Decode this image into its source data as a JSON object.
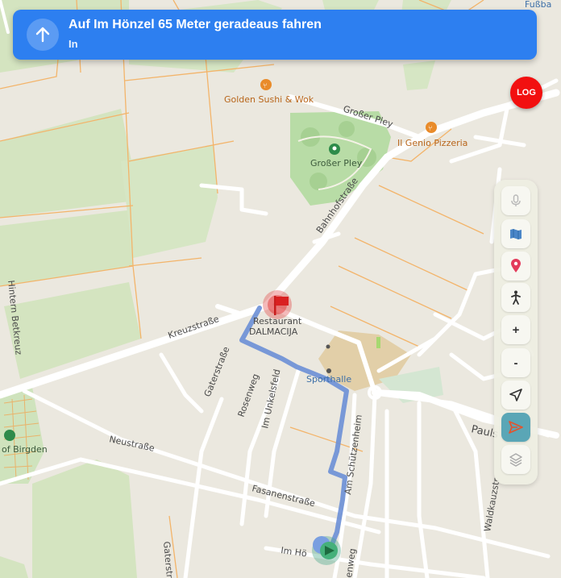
{
  "banner": {
    "instruction": "Auf Im Hönzel 65 Meter geradeaus fahren",
    "subtitle": "In",
    "color": "#2d7ff0"
  },
  "log_button": {
    "label": "LOG",
    "color": "#f21010"
  },
  "toolbar": {
    "items": [
      {
        "icon": "microphone-icon",
        "label": ""
      },
      {
        "icon": "map-book-icon",
        "label": ""
      },
      {
        "icon": "location-pin-icon",
        "label": ""
      },
      {
        "icon": "walking-person-icon",
        "label": ""
      },
      {
        "icon": "zoom-in-icon",
        "label": "+"
      },
      {
        "icon": "zoom-out-icon",
        "label": "-"
      },
      {
        "icon": "navigation-arrow-icon",
        "label": ""
      },
      {
        "icon": "send-route-icon",
        "label": ""
      },
      {
        "icon": "layers-icon",
        "label": ""
      }
    ]
  },
  "map": {
    "streets": {
      "kreuzstrasse": "Kreuzstraße",
      "bahnhofstrasse": "Bahnhofstraße",
      "grosser_pley_street": "Großer Pley",
      "hintern_betkreuz": "Hintern Betkreuz",
      "gaterstrasse_1": "Gaterstraße",
      "gaterstrasse_2": "Gaterstraße",
      "rosenweg": "Rosenweg",
      "im_unkelsfeld": "Im Unkelsfeld",
      "am_schuetzenheim": "Am Schützenheim",
      "neustrasse": "Neustraße",
      "fasanenstrasse": "Fasanenstraße",
      "paulsstrasse": "Pauls",
      "waldkauzstrasse": "Waldkauzstr",
      "im_hoenzel": "Im Hö",
      "am_schuetzenheim_lower": "enweg"
    },
    "pois": {
      "golden_sushi": "Golden Sushi & Wok",
      "il_genio": "Il Genio Pizzeria",
      "grosser_pley_park": "Großer Pley",
      "restaurant_name_1": "Restaurant",
      "restaurant_name_2": "DALMACIJA",
      "sporthalle": "Sporthalle",
      "of_birgden": "of Birgden",
      "fussball": "Fußba"
    },
    "colors": {
      "route": "#6b8fd6",
      "destination": "#e03a3a",
      "park": "#b8dca6",
      "water_land": "#d6e6c5",
      "major_road": "#ffffff",
      "minor_road": "#f6b36a"
    }
  }
}
